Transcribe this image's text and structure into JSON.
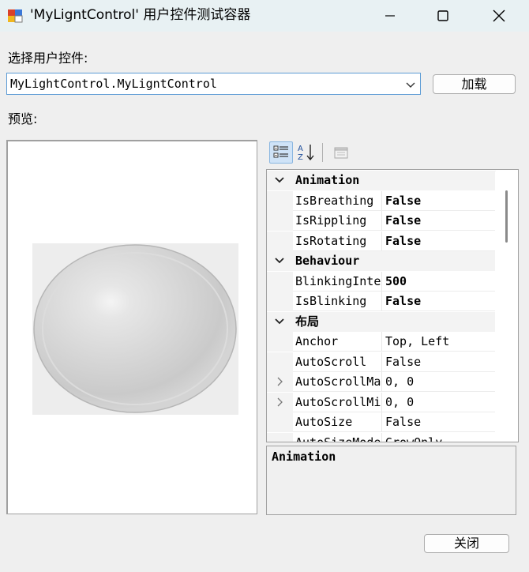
{
  "window": {
    "title": "'MyLigntControl' 用户控件测试容器"
  },
  "form": {
    "select_label": "选择用户控件:",
    "combo_value": "MyLightControl.MyLigntControl",
    "load_button": "加载",
    "preview_label": "预览:",
    "close_button": "关闭"
  },
  "propertygrid": {
    "rows": [
      {
        "type": "category",
        "name": "Animation"
      },
      {
        "type": "prop",
        "name": "IsBreathing",
        "value": "False",
        "bold": true
      },
      {
        "type": "prop",
        "name": "IsRippling",
        "value": "False",
        "bold": true
      },
      {
        "type": "prop",
        "name": "IsRotating",
        "value": "False",
        "bold": true
      },
      {
        "type": "category",
        "name": "Behaviour"
      },
      {
        "type": "prop",
        "name": "BlinkingInte",
        "value": "500",
        "bold": true
      },
      {
        "type": "prop",
        "name": "IsBlinking",
        "value": "False",
        "bold": true
      },
      {
        "type": "category",
        "name": "布局"
      },
      {
        "type": "prop",
        "name": "Anchor",
        "value": "Top, Left",
        "bold": false
      },
      {
        "type": "prop",
        "name": "AutoScroll",
        "value": "False",
        "bold": false
      },
      {
        "type": "prop",
        "name": "AutoScrollMa",
        "value": "0, 0",
        "bold": false,
        "expandable": true
      },
      {
        "type": "prop",
        "name": "AutoScrollMi",
        "value": "0, 0",
        "bold": false,
        "expandable": true
      },
      {
        "type": "prop",
        "name": "AutoSize",
        "value": "False",
        "bold": false
      },
      {
        "type": "prop",
        "name": "AutoSizeMode",
        "value": "GrowOnly",
        "bold": false
      }
    ]
  },
  "description": {
    "title": "Animation"
  },
  "colors": {
    "titlebar": "#e8f1f3",
    "accent_border": "#5b9bd5",
    "selected_toolbar": "#cfe3f7"
  }
}
